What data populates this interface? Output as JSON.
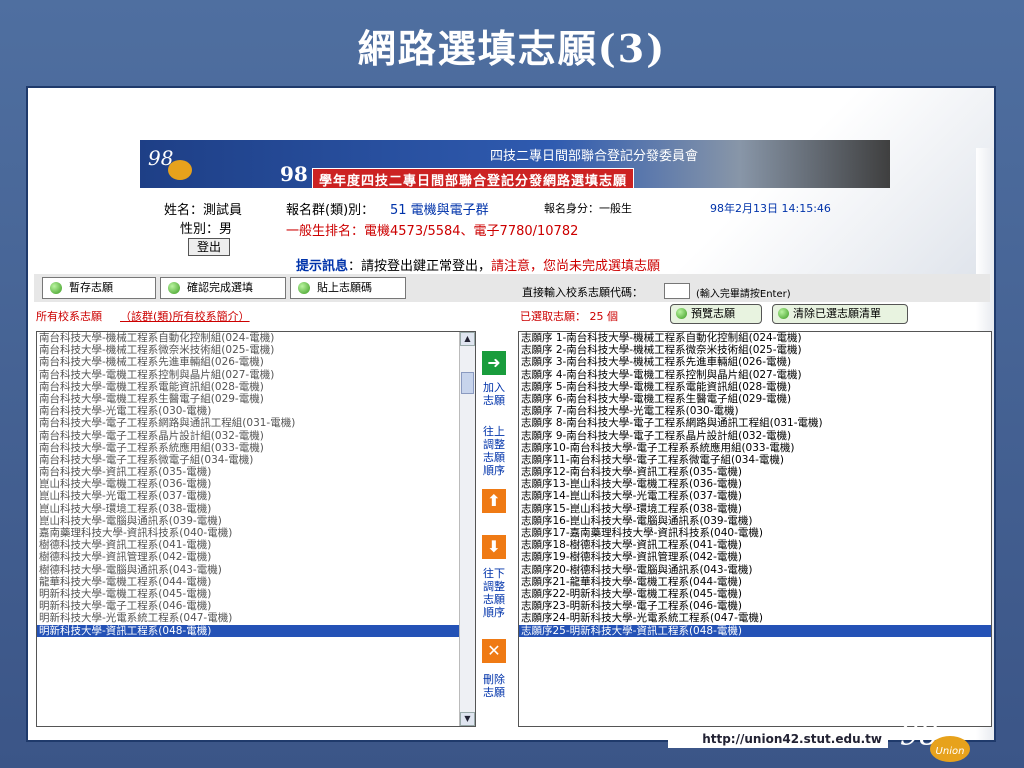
{
  "slide_title": "網路選填志願(3)",
  "banner": {
    "logo_num": "98",
    "committee": "四技二專日間部聯合登記分發委員會",
    "big_num": "98",
    "subtitle": "學年度四技二專日間部聯合登記分發網路選填志願"
  },
  "user": {
    "name_label": "姓名：測試員",
    "gender_label": "性別：男",
    "logout": "登出",
    "group_label": "報名群(類)別：",
    "group_value": "51 電機與電子群",
    "identity": "報名身分：一般生",
    "datetime": "98年2月13日 14:15:46",
    "rank_text": "一般生排名：電機4573/5584、電子7780/10782"
  },
  "notice": {
    "label": "提示訊息",
    "text1": "：請按登出鍵正常登出，",
    "text2": "請注意，您尚未完成選填志願"
  },
  "toolbar": {
    "save": "暫存志願",
    "confirm": "確認完成選填",
    "paste": "貼上志願碼",
    "code_label": "直接輸入校系志願代碼：",
    "code_hint": "(輸入完畢請按Enter)"
  },
  "left_header": {
    "all": "所有校系志願",
    "intro": "（該群(類)所有校系簡介）"
  },
  "right_header": {
    "selected": "已選取志願： 25 個",
    "preview": "預覽志願",
    "clear": "清除已選志願清單"
  },
  "middle": {
    "add": "加入志願",
    "up": "往上調整志願順序",
    "down": "往下調整志願順序",
    "delete": "刪除志願"
  },
  "left_list": [
    "南台科技大學-機械工程系自動化控制組(024-電機)",
    "南台科技大學-機械工程系微奈米技術組(025-電機)",
    "南台科技大學-機械工程系先進車輛組(026-電機)",
    "南台科技大學-電機工程系控制與晶片組(027-電機)",
    "南台科技大學-電機工程系電能資訊組(028-電機)",
    "南台科技大學-電機工程系生醫電子組(029-電機)",
    "南台科技大學-光電工程系(030-電機)",
    "南台科技大學-電子工程系網路與通訊工程組(031-電機)",
    "南台科技大學-電子工程系晶片設計組(032-電機)",
    "南台科技大學-電子工程系系統應用組(033-電機)",
    "南台科技大學-電子工程系微電子組(034-電機)",
    "南台科技大學-資訊工程系(035-電機)",
    "崑山科技大學-電機工程系(036-電機)",
    "崑山科技大學-光電工程系(037-電機)",
    "崑山科技大學-環境工程系(038-電機)",
    "崑山科技大學-電腦與通訊系(039-電機)",
    "嘉南藥理科技大學-資訊科技系(040-電機)",
    "樹德科技大學-資訊工程系(041-電機)",
    "樹德科技大學-資訊管理系(042-電機)",
    "樹德科技大學-電腦與通訊系(043-電機)",
    "龍華科技大學-電機工程系(044-電機)",
    "明新科技大學-電機工程系(045-電機)",
    "明新科技大學-電子工程系(046-電機)",
    "明新科技大學-光電系統工程系(047-電機)",
    "明新科技大學-資訊工程系(048-電機)"
  ],
  "right_list": [
    "志願序 1-南台科技大學-機械工程系自動化控制組(024-電機)",
    "志願序 2-南台科技大學-機械工程系微奈米技術組(025-電機)",
    "志願序 3-南台科技大學-機械工程系先進車輛組(026-電機)",
    "志願序 4-南台科技大學-電機工程系控制與晶片組(027-電機)",
    "志願序 5-南台科技大學-電機工程系電能資訊組(028-電機)",
    "志願序 6-南台科技大學-電機工程系生醫電子組(029-電機)",
    "志願序 7-南台科技大學-光電工程系(030-電機)",
    "志願序 8-南台科技大學-電子工程系網路與通訊工程組(031-電機)",
    "志願序 9-南台科技大學-電子工程系晶片設計組(032-電機)",
    "志願序10-南台科技大學-電子工程系系統應用組(033-電機)",
    "志願序11-南台科技大學-電子工程系微電子組(034-電機)",
    "志願序12-南台科技大學-資訊工程系(035-電機)",
    "志願序13-崑山科技大學-電機工程系(036-電機)",
    "志願序14-崑山科技大學-光電工程系(037-電機)",
    "志願序15-崑山科技大學-環境工程系(038-電機)",
    "志願序16-崑山科技大學-電腦與通訊系(039-電機)",
    "志願序17-嘉南藥理科技大學-資訊科技系(040-電機)",
    "志願序18-樹德科技大學-資訊工程系(041-電機)",
    "志願序19-樹德科技大學-資訊管理系(042-電機)",
    "志願序20-樹德科技大學-電腦與通訊系(043-電機)",
    "志願序21-龍華科技大學-電機工程系(044-電機)",
    "志願序22-明新科技大學-電機工程系(045-電機)",
    "志願序23-明新科技大學-電子工程系(046-電機)",
    "志願序24-明新科技大學-光電系統工程系(047-電機)",
    "志願序25-明新科技大學-資訊工程系(048-電機)"
  ],
  "footer": {
    "url": "http://union42.stut.edu.tw",
    "logo_num": "98",
    "logo_word": "Union"
  }
}
